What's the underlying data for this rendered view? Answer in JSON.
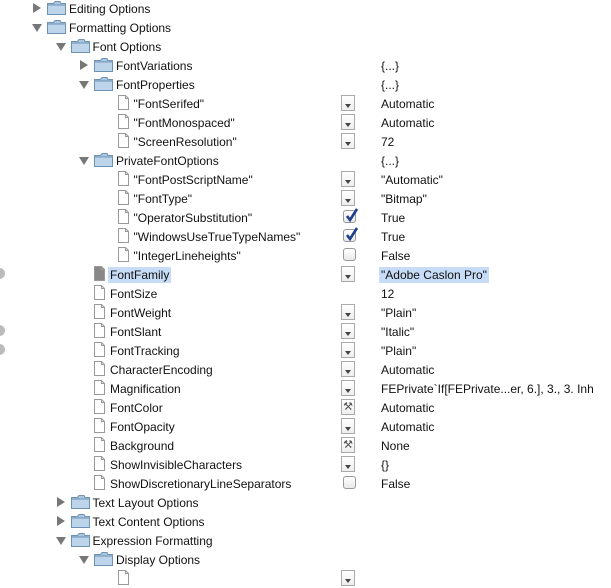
{
  "colors": {
    "selection": "#c7dcf7",
    "folder": "#8fb3d4"
  },
  "rows": [
    {
      "level": 0,
      "kind": "folder",
      "expanded": false,
      "name": "Editing Options"
    },
    {
      "level": 0,
      "kind": "folder",
      "expanded": true,
      "name": "Formatting Options"
    },
    {
      "level": 1,
      "kind": "folder",
      "expanded": true,
      "name": "Font Options"
    },
    {
      "level": 2,
      "kind": "folder",
      "expanded": false,
      "name": "FontVariations",
      "value": "{...}"
    },
    {
      "level": 2,
      "kind": "folder",
      "expanded": true,
      "name": "FontProperties",
      "value": "{...}"
    },
    {
      "level": 3,
      "kind": "file",
      "name": "\"FontSerifed\"",
      "control": "dropdown",
      "value": "Automatic"
    },
    {
      "level": 3,
      "kind": "file",
      "name": "\"FontMonospaced\"",
      "control": "dropdown",
      "value": "Automatic"
    },
    {
      "level": 3,
      "kind": "file",
      "name": "\"ScreenResolution\"",
      "control": "dropdown",
      "value": "72"
    },
    {
      "level": 2,
      "kind": "folder",
      "expanded": true,
      "name": "PrivateFontOptions",
      "value": "{...}"
    },
    {
      "level": 3,
      "kind": "file",
      "name": "\"FontPostScriptName\"",
      "control": "dropdown",
      "value": "\"Automatic\""
    },
    {
      "level": 3,
      "kind": "file",
      "name": "\"FontType\"",
      "control": "dropdown",
      "value": "\"Bitmap\""
    },
    {
      "level": 3,
      "kind": "file",
      "name": "\"OperatorSubstitution\"",
      "control": "checkbox",
      "checked": true,
      "value": "True"
    },
    {
      "level": 3,
      "kind": "file",
      "name": "\"WindowsUseTrueTypeNames\"",
      "control": "checkbox",
      "checked": true,
      "value": "True"
    },
    {
      "level": 3,
      "kind": "file",
      "name": "\"IntegerLineheights\"",
      "control": "checkbox",
      "checked": false,
      "value": "False"
    },
    {
      "level": 2,
      "kind": "file",
      "name": "FontFamily",
      "control": "dropdown",
      "value": "\"Adobe Caslon Pro\"",
      "selected": true,
      "modified": true
    },
    {
      "level": 2,
      "kind": "file",
      "name": "FontSize",
      "value": "12"
    },
    {
      "level": 2,
      "kind": "file",
      "name": "FontWeight",
      "control": "dropdown",
      "value": "\"Plain\""
    },
    {
      "level": 2,
      "kind": "file",
      "name": "FontSlant",
      "control": "dropdown",
      "value": "\"Italic\"",
      "modified": true
    },
    {
      "level": 2,
      "kind": "file",
      "name": "FontTracking",
      "control": "dropdown",
      "value": "\"Plain\"",
      "modified": true
    },
    {
      "level": 2,
      "kind": "file",
      "name": "CharacterEncoding",
      "control": "dropdown",
      "value": "Automatic"
    },
    {
      "level": 2,
      "kind": "file",
      "name": "Magnification",
      "control": "dropdown",
      "value": "FEPrivate`If[FEPrivate...er, 6.], 3., 3. Inh"
    },
    {
      "level": 2,
      "kind": "file",
      "name": "FontColor",
      "control": "tool",
      "value": "Automatic"
    },
    {
      "level": 2,
      "kind": "file",
      "name": "FontOpacity",
      "control": "dropdown",
      "value": "Automatic"
    },
    {
      "level": 2,
      "kind": "file",
      "name": "Background",
      "control": "tool",
      "value": "None"
    },
    {
      "level": 2,
      "kind": "file",
      "name": "ShowInvisibleCharacters",
      "control": "dropdown",
      "value": "{}"
    },
    {
      "level": 2,
      "kind": "file",
      "name": "ShowDiscretionaryLineSeparators",
      "control": "checkbox",
      "checked": false,
      "value": "False"
    },
    {
      "level": 1,
      "kind": "folder",
      "expanded": false,
      "name": "Text Layout Options"
    },
    {
      "level": 1,
      "kind": "folder",
      "expanded": false,
      "name": "Text Content Options"
    },
    {
      "level": 1,
      "kind": "folder",
      "expanded": true,
      "name": "Expression Formatting"
    },
    {
      "level": 2,
      "kind": "folder",
      "expanded": true,
      "name": "Display Options"
    },
    {
      "level": 3,
      "kind": "file",
      "name": "",
      "control": "dropdown"
    }
  ]
}
